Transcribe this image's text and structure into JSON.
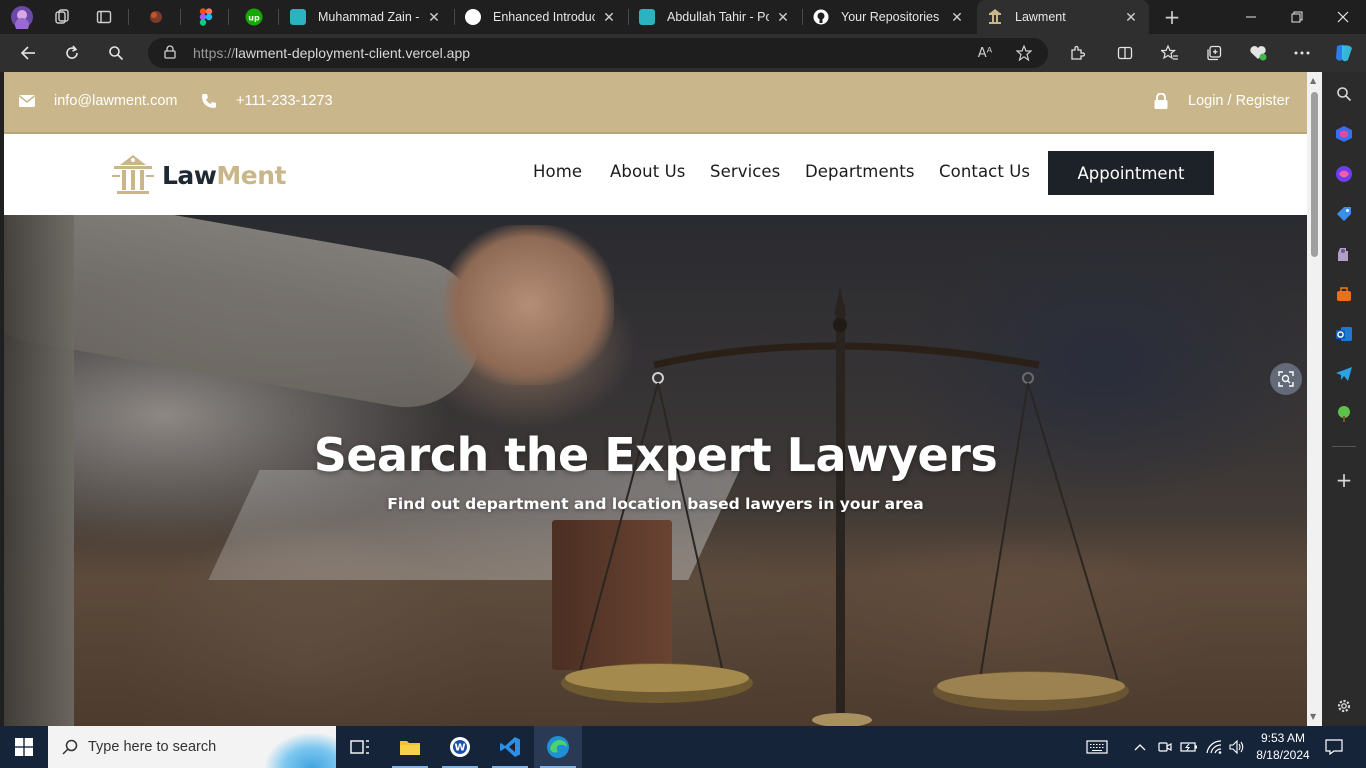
{
  "browser": {
    "tabs": [
      {
        "title": "Muhammad Zain - P",
        "active": false,
        "favicon_color": "#2bb3c0"
      },
      {
        "title": "Enhanced Introducti",
        "active": false,
        "favicon_color": "#ffffff"
      },
      {
        "title": "Abdullah Tahir - Porf",
        "active": false,
        "favicon_color": "#2bb3c0"
      },
      {
        "title": "Your Repositories",
        "active": false,
        "favicon_color": "#ffffff"
      },
      {
        "title": "Lawment",
        "active": true,
        "favicon_color": "#c9b68b"
      }
    ],
    "url_prefix": "https://",
    "url_host": "lawment-deployment-client.vercel.app"
  },
  "site": {
    "topbar": {
      "email": "info@lawment.com",
      "phone": "+111-233-1273",
      "login": "Login / Register"
    },
    "logo": {
      "part1": "Law",
      "part2": "Ment"
    },
    "nav": {
      "home": "Home",
      "about": "About Us",
      "services": "Services",
      "departments": "Departments",
      "contact": "Contact Us",
      "appointment": "Appointment"
    },
    "hero": {
      "title": "Search the Expert Lawyers",
      "subtitle": "Find out department and location based lawyers in your area"
    },
    "colors": {
      "accent": "#c9b68b",
      "dark": "#1c2228"
    }
  },
  "taskbar": {
    "search_placeholder": "Type here to search",
    "time": "9:53 AM",
    "date": "8/18/2024"
  }
}
